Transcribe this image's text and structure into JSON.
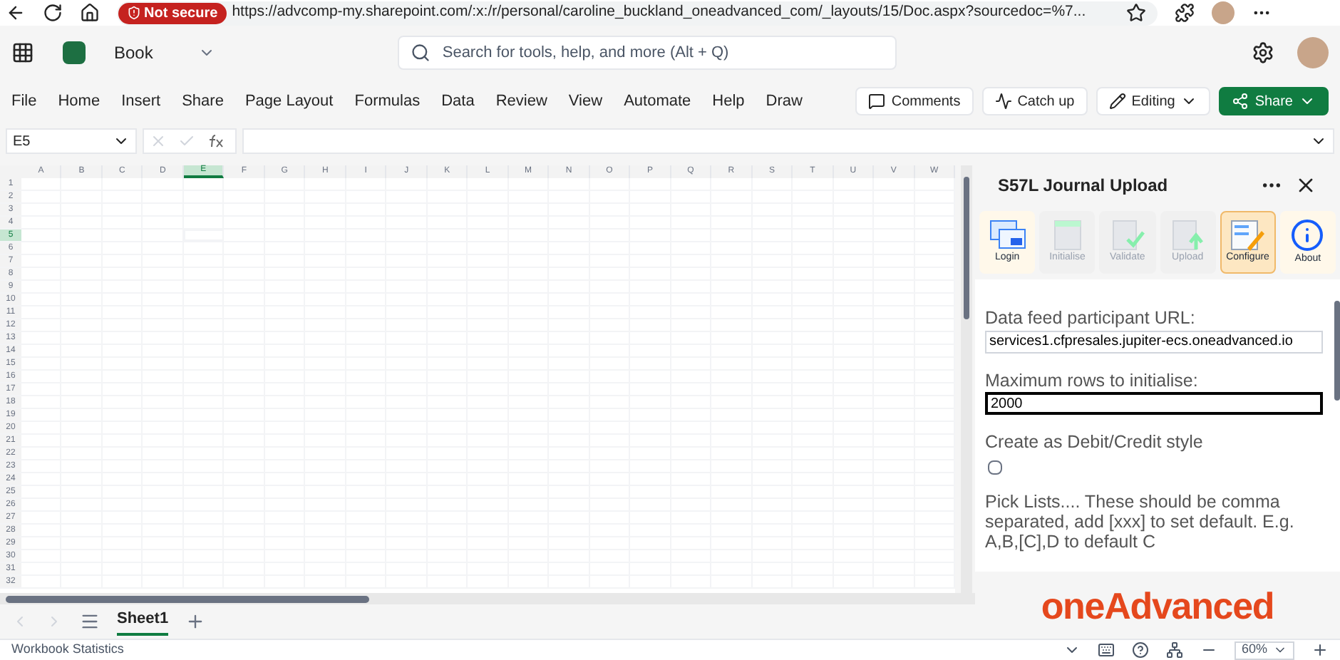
{
  "browser": {
    "security_badge": "Not secure",
    "url": "https://advcomp-my.sharepoint.com/:x:/r/personal/caroline_buckland_oneadvanced_com/_layouts/15/Doc.aspx?sourcedoc=%7..."
  },
  "app": {
    "file_name": "Book",
    "search_placeholder": "Search for tools, help, and more (Alt + Q)"
  },
  "ribbon_tabs": [
    {
      "label": "File",
      "selected": false
    },
    {
      "label": "Home",
      "selected": false
    },
    {
      "label": "Insert",
      "selected": false
    },
    {
      "label": "Share",
      "selected": false
    },
    {
      "label": "Page Layout",
      "selected": false
    },
    {
      "label": "Formulas",
      "selected": false
    },
    {
      "label": "Data",
      "selected": false
    },
    {
      "label": "Review",
      "selected": false
    },
    {
      "label": "View",
      "selected": false
    },
    {
      "label": "Automate",
      "selected": false
    },
    {
      "label": "Help",
      "selected": false
    },
    {
      "label": "Draw",
      "selected": false
    }
  ],
  "ribbon_buttons": [
    {
      "kind": "comments",
      "label": "Comments"
    },
    {
      "kind": "catchup",
      "label": "Catch up"
    },
    {
      "kind": "editing",
      "label": "Editing"
    },
    {
      "kind": "share",
      "label": "Share"
    }
  ],
  "formula_bar": {
    "name_box": "E5"
  },
  "grid": {
    "columns": [
      {
        "label": "A",
        "selected": false
      },
      {
        "label": "B",
        "selected": false
      },
      {
        "label": "C",
        "selected": false
      },
      {
        "label": "D",
        "selected": false
      },
      {
        "label": "E",
        "selected": true
      },
      {
        "label": "F",
        "selected": false
      },
      {
        "label": "G",
        "selected": false
      },
      {
        "label": "H",
        "selected": false
      },
      {
        "label": "I",
        "selected": false
      },
      {
        "label": "J",
        "selected": false
      },
      {
        "label": "K",
        "selected": false
      },
      {
        "label": "L",
        "selected": false
      },
      {
        "label": "M",
        "selected": false
      },
      {
        "label": "N",
        "selected": false
      },
      {
        "label": "O",
        "selected": false
      },
      {
        "label": "P",
        "selected": false
      },
      {
        "label": "Q",
        "selected": false
      },
      {
        "label": "R",
        "selected": false
      },
      {
        "label": "S",
        "selected": false
      },
      {
        "label": "T",
        "selected": false
      },
      {
        "label": "U",
        "selected": false
      },
      {
        "label": "V",
        "selected": false
      },
      {
        "label": "W",
        "selected": false
      }
    ],
    "rows": [
      {
        "label": "1",
        "selected": false
      },
      {
        "label": "2",
        "selected": false
      },
      {
        "label": "3",
        "selected": false
      },
      {
        "label": "4",
        "selected": false
      },
      {
        "label": "5",
        "selected": true
      },
      {
        "label": "6",
        "selected": false
      },
      {
        "label": "7",
        "selected": false
      },
      {
        "label": "8",
        "selected": false
      },
      {
        "label": "9",
        "selected": false
      },
      {
        "label": "10",
        "selected": false
      },
      {
        "label": "11",
        "selected": false
      },
      {
        "label": "12",
        "selected": false
      },
      {
        "label": "13",
        "selected": false
      },
      {
        "label": "14",
        "selected": false
      },
      {
        "label": "15",
        "selected": false
      },
      {
        "label": "16",
        "selected": false
      },
      {
        "label": "17",
        "selected": false
      },
      {
        "label": "18",
        "selected": false
      },
      {
        "label": "19",
        "selected": false
      },
      {
        "label": "20",
        "selected": false
      },
      {
        "label": "21",
        "selected": false
      },
      {
        "label": "22",
        "selected": false
      },
      {
        "label": "23",
        "selected": false
      },
      {
        "label": "24",
        "selected": false
      },
      {
        "label": "25",
        "selected": false
      },
      {
        "label": "26",
        "selected": false
      },
      {
        "label": "27",
        "selected": false
      },
      {
        "label": "28",
        "selected": false
      },
      {
        "label": "29",
        "selected": false
      },
      {
        "label": "30",
        "selected": false
      },
      {
        "label": "31",
        "selected": false
      },
      {
        "label": "32",
        "selected": false
      }
    ]
  },
  "sheet_tabs": [
    {
      "label": "Sheet1",
      "selected": true
    }
  ],
  "task_pane": {
    "title": "S57L Journal Upload",
    "toolbar": [
      {
        "kind": "login",
        "label": "Login",
        "disabled": false,
        "selected": false
      },
      {
        "kind": "initialise",
        "label": "Initialise",
        "disabled": true,
        "selected": false
      },
      {
        "kind": "validate",
        "label": "Validate",
        "disabled": true,
        "selected": false
      },
      {
        "kind": "upload",
        "label": "Upload",
        "disabled": true,
        "selected": false
      },
      {
        "kind": "configure",
        "label": "Configure",
        "disabled": false,
        "selected": true
      },
      {
        "kind": "about",
        "label": "About",
        "disabled": false,
        "selected": false
      }
    ],
    "fields": [
      {
        "kind": "input",
        "label": "Data feed participant URL:",
        "value": "services1.cfpresales.jupiter-ecs.oneadvanced.io",
        "focused": false
      },
      {
        "kind": "input",
        "label": "Maximum rows to initialise:",
        "value": "2000",
        "focused": true
      },
      {
        "kind": "checkbox",
        "label": "Create as Debit/Credit style",
        "checked": false
      },
      {
        "kind": "text",
        "label": "Pick Lists.... These should be comma separated, add [xxx] to set default. E.g. A,B,[C],D to default C"
      }
    ],
    "logo": "oneAdvanced"
  },
  "status_bar": {
    "left": "Workbook Statistics",
    "zoom": "60%"
  }
}
